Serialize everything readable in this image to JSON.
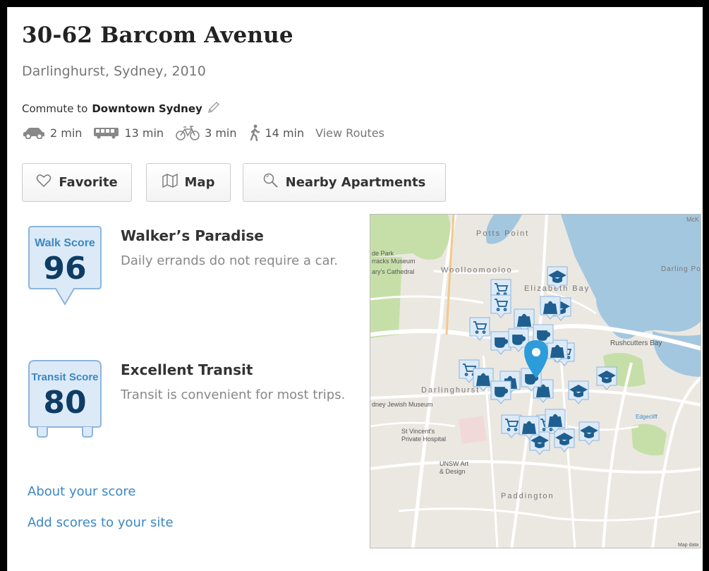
{
  "address": {
    "title": "30-62 Barcom Avenue",
    "subtitle": "Darlinghurst, Sydney, 2010"
  },
  "commute": {
    "prefix": "Commute to",
    "destination": "Downtown Sydney",
    "modes": [
      {
        "icon": "car-icon",
        "time": "2 min"
      },
      {
        "icon": "bus-icon",
        "time": "13 min"
      },
      {
        "icon": "bike-icon",
        "time": "3 min"
      },
      {
        "icon": "walk-icon",
        "time": "14 min"
      }
    ],
    "view_routes": "View Routes"
  },
  "buttons": {
    "favorite": "Favorite",
    "map": "Map",
    "nearby": "Nearby Apartments"
  },
  "walk_score": {
    "badge_label": "Walk Score",
    "value": "96",
    "title": "Walker’s Paradise",
    "description": "Daily errands do not require a car."
  },
  "transit_score": {
    "badge_label": "Transit Score",
    "value": "80",
    "title": "Excellent Transit",
    "description": "Transit is convenient for most trips."
  },
  "links": {
    "about": "About your score",
    "add": "Add scores to your site"
  },
  "map": {
    "labels": {
      "potts_point": "Potts Point",
      "woolloomooloo": "Woolloomooloo",
      "elizabeth_bay": "Elizabeth Bay",
      "rushcutters_bay": "Rushcutters Bay",
      "darlinghurst": "Darlinghurst",
      "paddington": "Paddington",
      "darling_point": "Darling Po",
      "park_museum": "de Park\nrracks Museum",
      "cathedral": "ary's Cathedral",
      "jewish_museum": "dney Jewish Museum",
      "st_vincents": "St Vincent's\nPrivate Hospital",
      "unsw": "UNSW Art\n& Design",
      "edgecliff": "Edgecliff",
      "map_data": "Map data",
      "mck": "McK"
    },
    "colors": {
      "water": "#a3c7df",
      "park": "#c6dfa8",
      "road": "#ffffff",
      "land": "#ebe8e2",
      "pin": "#2d9cdb",
      "marker": "#1f5f8f"
    }
  }
}
